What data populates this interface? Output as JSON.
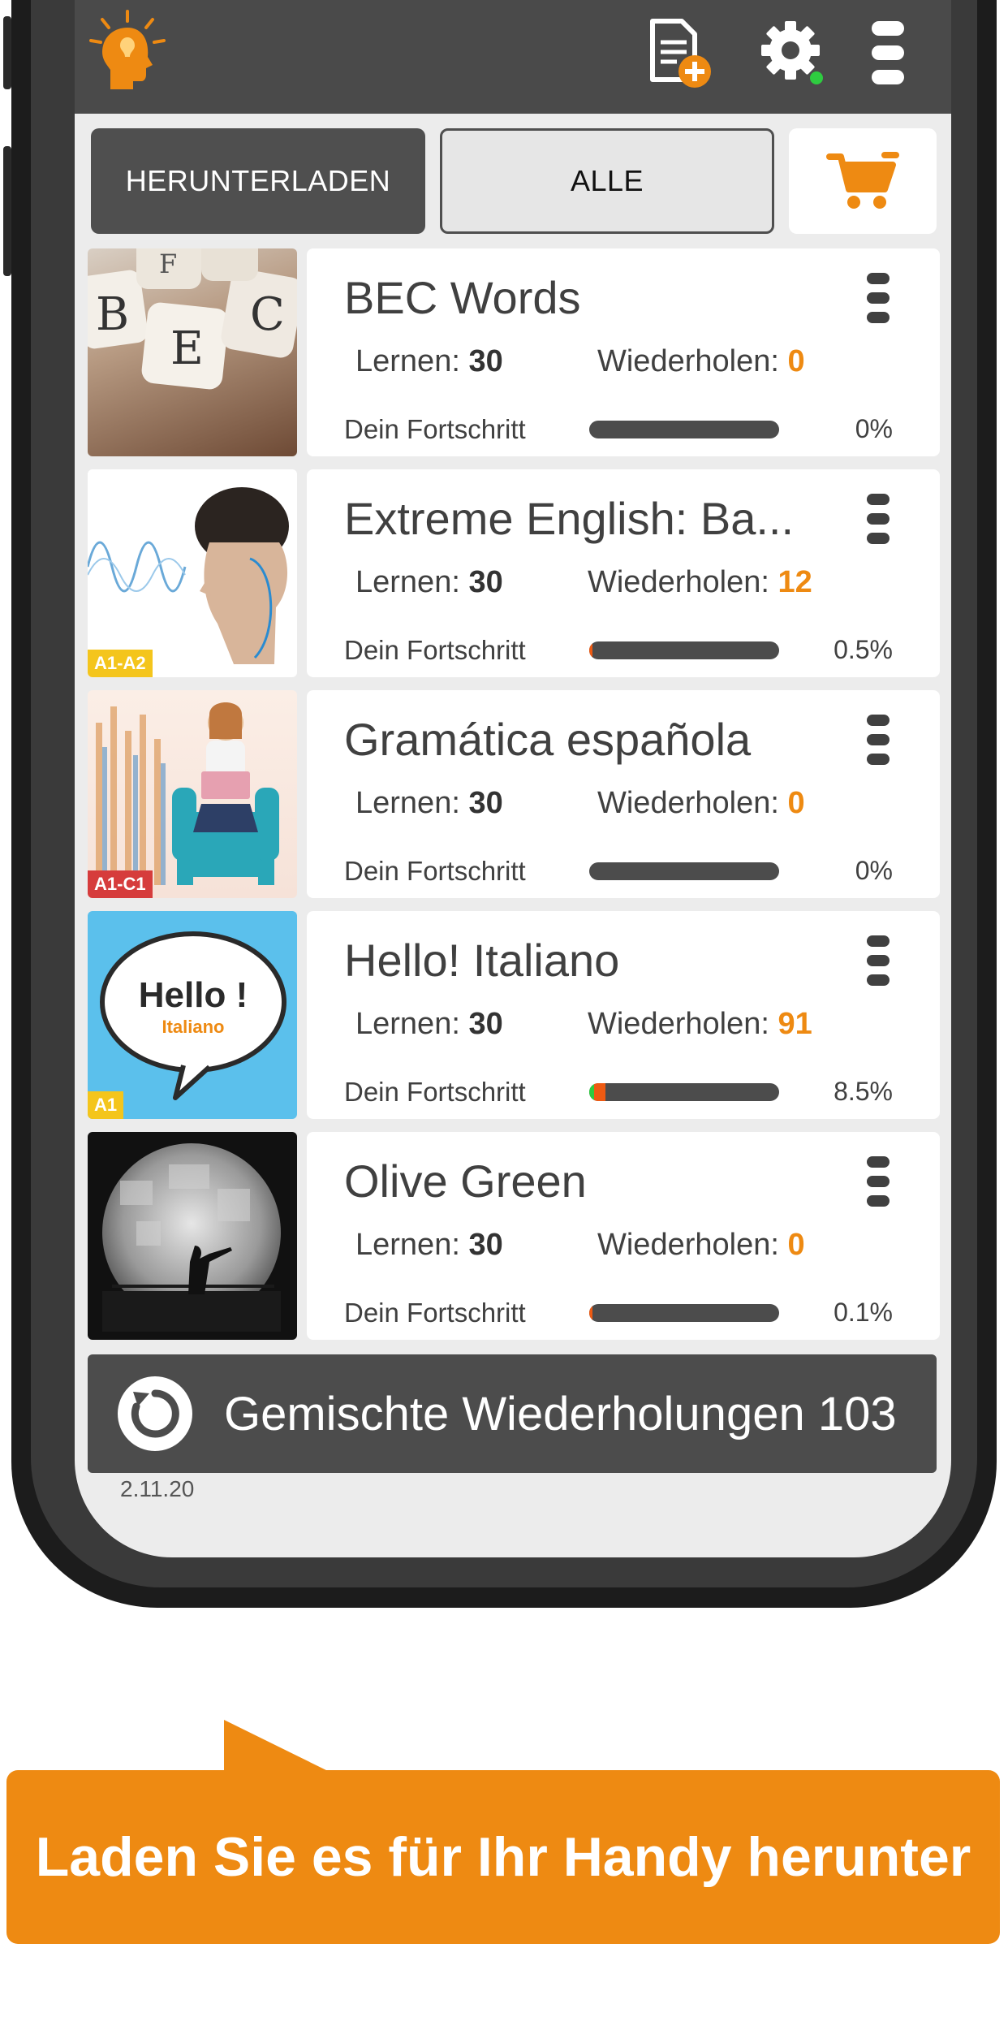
{
  "tabs": {
    "download_label": "HERUNTERLADEN",
    "all_label": "ALLE"
  },
  "icons": {
    "logo": "lightbulb-head-logo",
    "add_file": "add-document-icon",
    "settings": "gear-icon",
    "more": "more-vertical-icon",
    "cart": "shopping-cart-icon",
    "refresh": "refresh-icon"
  },
  "colors": {
    "accent": "#ee8a12",
    "dark_bar": "#4a4a4a",
    "status_dot": "#2ecc40"
  },
  "courses": [
    {
      "title": "BEC Words",
      "learn_label": "Lernen:",
      "learn_count": "30",
      "repeat_label": "Wiederholen:",
      "repeat_count": "0",
      "progress_label": "Dein Fortschritt",
      "progress_pct": "0%",
      "progress_value": 0,
      "badge": ""
    },
    {
      "title": "Extreme English: Ba...",
      "learn_label": "Lernen:",
      "learn_count": "30",
      "repeat_label": "Wiederholen:",
      "repeat_count": "12",
      "progress_label": "Dein Fortschritt",
      "progress_pct": "0.5%",
      "progress_value": 0.5,
      "badge": "A1-A2"
    },
    {
      "title": "Gramática española",
      "learn_label": "Lernen:",
      "learn_count": "30",
      "repeat_label": "Wiederholen:",
      "repeat_count": "0",
      "progress_label": "Dein Fortschritt",
      "progress_pct": "0%",
      "progress_value": 0,
      "badge": "A1-C1"
    },
    {
      "title": "Hello! Italiano",
      "learn_label": "Lernen:",
      "learn_count": "30",
      "repeat_label": "Wiederholen:",
      "repeat_count": "91",
      "progress_label": "Dein Fortschritt",
      "progress_pct": "8.5%",
      "progress_value": 8.5,
      "badge": "A1"
    },
    {
      "title": "Olive Green",
      "learn_label": "Lernen:",
      "learn_count": "30",
      "repeat_label": "Wiederholen:",
      "repeat_count": "0",
      "progress_label": "Dein Fortschritt",
      "progress_pct": "0.1%",
      "progress_value": 0.1,
      "badge": ""
    }
  ],
  "thumb_text": {
    "bec_letters": [
      "B",
      "E",
      "C",
      "F"
    ],
    "hello_main": "Hello !",
    "hello_sub": "Italiano"
  },
  "mixed_repeat": {
    "label": "Gemischte Wiederholungen 103"
  },
  "version": "2.11.20",
  "banner": {
    "text": "Laden Sie es für Ihr Handy herunter"
  }
}
